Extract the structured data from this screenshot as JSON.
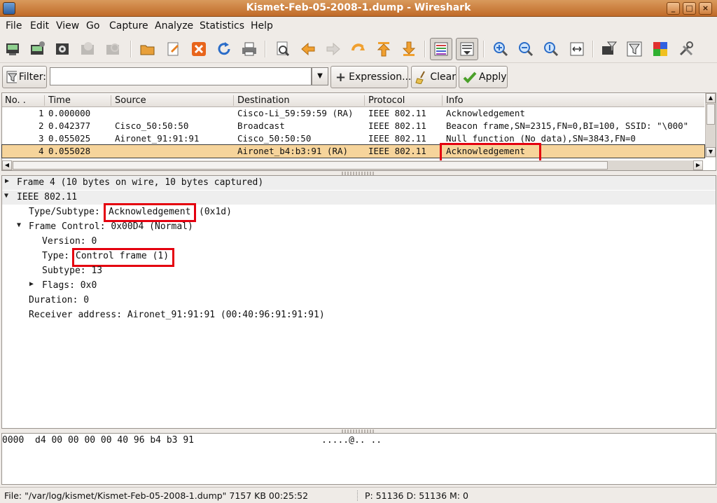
{
  "window": {
    "title": "Kismet-Feb-05-2008-1.dump - Wireshark"
  },
  "menu": [
    "File",
    "Edit",
    "View",
    "Go",
    "Capture",
    "Analyze",
    "Statistics",
    "Help"
  ],
  "toolbar_icons": [
    "interface-list-icon",
    "capture-options-icon",
    "start-capture-icon",
    "stop-capture-icon",
    "restart-capture-icon",
    "open-file-icon",
    "edit-file-icon",
    "close-file-icon",
    "reload-icon",
    "print-icon",
    "find-packet-icon",
    "go-back-icon",
    "go-forward-icon",
    "go-to-packet-icon",
    "first-packet-icon",
    "last-packet-icon",
    "colorize-icon",
    "auto-scroll-icon",
    "zoom-in-icon",
    "zoom-out-icon",
    "zoom-normal-icon",
    "resize-columns-icon",
    "capture-filters-icon",
    "display-filters-icon",
    "coloring-rules-icon",
    "preferences-icon"
  ],
  "filter": {
    "label": "Filter:",
    "value": "",
    "expression_label": "Expression...",
    "clear_label": "Clear",
    "apply_label": "Apply"
  },
  "packet_list": {
    "columns": [
      "No. .",
      "Time",
      "Source",
      "Destination",
      "Protocol",
      "Info"
    ],
    "rows": [
      {
        "no": "1",
        "time": "0.000000",
        "source": "",
        "destination": "Cisco-Li_59:59:59 (RA)",
        "protocol": "IEEE 802.11",
        "info": "Acknowledgement"
      },
      {
        "no": "2",
        "time": "0.042377",
        "source": "Cisco_50:50:50",
        "destination": "Broadcast",
        "protocol": "IEEE 802.11",
        "info": "Beacon frame,SN=2315,FN=0,BI=100, SSID: \"\\000\""
      },
      {
        "no": "3",
        "time": "0.055025",
        "source": "Aironet_91:91:91",
        "destination": "Cisco_50:50:50",
        "protocol": "IEEE 802.11",
        "info": "Null function (No data),SN=3843,FN=0"
      },
      {
        "no": "4",
        "time": "0.055028",
        "source": "",
        "destination": "Aironet_b4:b3:91 (RA)",
        "protocol": "IEEE 802.11",
        "info": "Acknowledgement"
      }
    ]
  },
  "details": {
    "frame": "Frame 4 (10 bytes on wire, 10 bytes captured)",
    "ieee": "IEEE 802.11",
    "type_subtype_label": "Type/Subtype:",
    "type_subtype_value": "Acknowledgement",
    "type_subtype_code": "(0x1d)",
    "frame_control": "Frame Control: 0x00D4 (Normal)",
    "version": "Version: 0",
    "type_label": "Type:",
    "type_value": "Control frame (1)",
    "subtype": "Subtype: 13",
    "flags": "Flags: 0x0",
    "duration": "Duration: 0",
    "receiver": "Receiver address: Aironet_91:91:91 (00:40:96:91:91:91)"
  },
  "bytes": {
    "offset": "0000",
    "hex": "d4 00 00 00 00 40 96 b4  b3 91",
    "ascii": ".....@.. .."
  },
  "status": {
    "file": "File: \"/var/log/kismet/Kismet-Feb-05-2008-1.dump\" 7157 KB 00:25:52",
    "counts": "P: 51136 D: 51136 M: 0"
  },
  "colors": {
    "titlebar": "#c8783a",
    "selected_row": "#f6d49b",
    "highlight_box": "#e4000f"
  }
}
